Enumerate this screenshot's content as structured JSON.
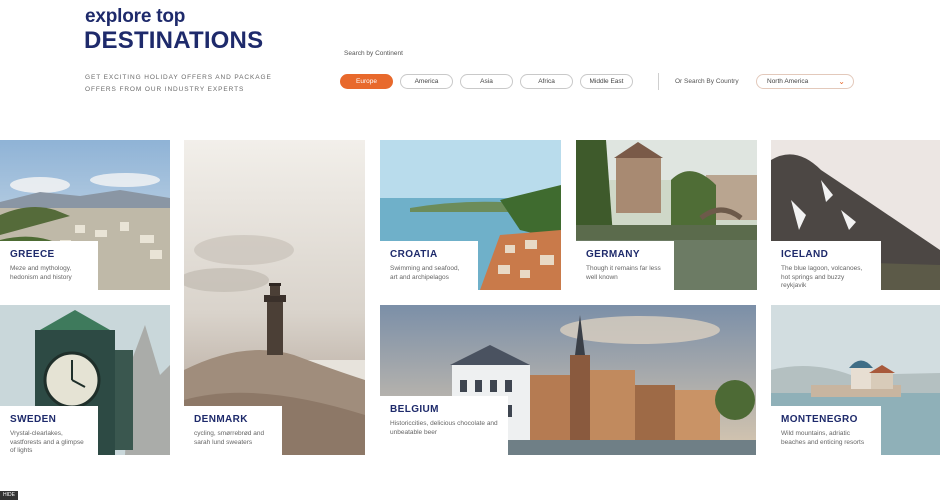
{
  "header": {
    "title_small": "explore top",
    "title_big": "DESTINATIONS",
    "tagline": "GET EXCITING HOLIDAY OFFERS AND PACKAGE OFFERS FROM OUR INDUSTRY EXPERTS"
  },
  "search": {
    "continent_label": "Search by Continent",
    "continents": [
      "Europe",
      "America",
      "Asia",
      "Africa",
      "Middle East"
    ],
    "selected_continent": "Europe",
    "country_label": "Or Search By Country",
    "country_value": "North America"
  },
  "destinations": [
    {
      "name": "GREECE",
      "desc": "Meze and mythology, hedonism and history"
    },
    {
      "name": "DENMARK",
      "desc": "cycling, smørrebrød and sarah lund sweaters"
    },
    {
      "name": "CROATIA",
      "desc": "Swimming and seafood, art and archipelagos"
    },
    {
      "name": "GERMANY",
      "desc": "Though it remains far less well known"
    },
    {
      "name": "ICELAND",
      "desc": "The blue lagoon, volcanoes, hot springs and buzzy reykjavik"
    },
    {
      "name": "SWEDEN",
      "desc": "Vrystal-clearlakes, vastforests and a glimpse of lights"
    },
    {
      "name": "BELGIUM",
      "desc": "Historiccities, delicious chocolate and unbeatable beer"
    },
    {
      "name": "MONTENEGRO",
      "desc": "Wild mountains, adriatic beaches and enticing resorts"
    }
  ],
  "hide_label": "HIDE",
  "colors": {
    "accent": "#e8692c",
    "brand_navy": "#1e2a6b"
  }
}
